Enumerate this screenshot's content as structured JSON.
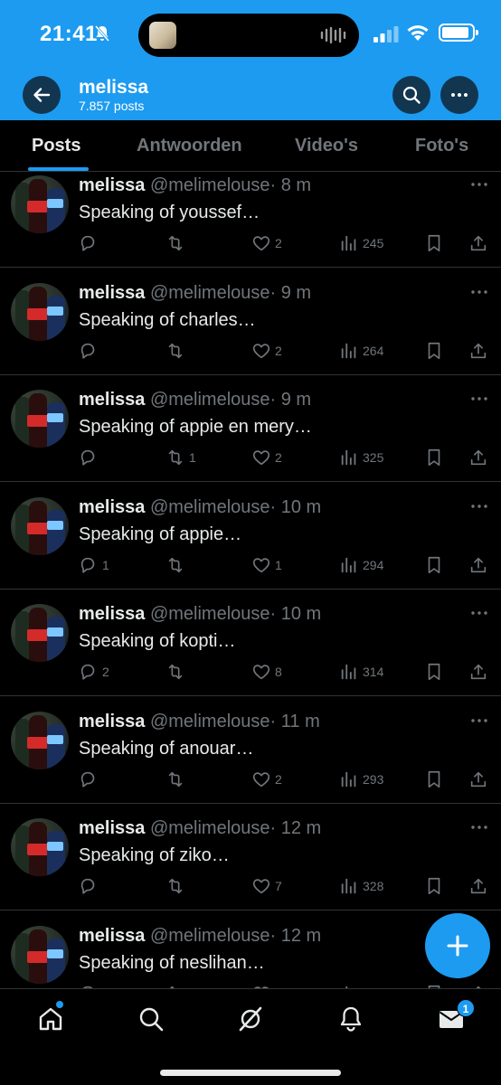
{
  "status_bar": {
    "time": "21:41"
  },
  "header": {
    "name": "melissa",
    "posts_count": "7.857 posts"
  },
  "tabs": [
    {
      "label": "Posts",
      "active": true
    },
    {
      "label": "Antwoorden",
      "active": false
    },
    {
      "label": "Video's",
      "active": false
    },
    {
      "label": "Foto's",
      "active": false
    }
  ],
  "posts": [
    {
      "name": "melissa",
      "handle": "@melimelouse",
      "time": "· 8 m",
      "text": "Speaking of youssef…",
      "replies": "",
      "reposts": "",
      "likes": "2",
      "views": "245"
    },
    {
      "name": "melissa",
      "handle": "@melimelouse",
      "time": "· 9 m",
      "text": "Speaking of charles…",
      "replies": "",
      "reposts": "",
      "likes": "2",
      "views": "264"
    },
    {
      "name": "melissa",
      "handle": "@melimelouse",
      "time": "· 9 m",
      "text": "Speaking of appie en mery…",
      "replies": "",
      "reposts": "1",
      "likes": "2",
      "views": "325"
    },
    {
      "name": "melissa",
      "handle": "@melimelouse",
      "time": "· 10 m",
      "text": "Speaking of appie…",
      "replies": "1",
      "reposts": "",
      "likes": "1",
      "views": "294"
    },
    {
      "name": "melissa",
      "handle": "@melimelouse",
      "time": "· 10 m",
      "text": "Speaking of kopti…",
      "replies": "2",
      "reposts": "",
      "likes": "8",
      "views": "314"
    },
    {
      "name": "melissa",
      "handle": "@melimelouse",
      "time": "· 11 m",
      "text": "Speaking of anouar…",
      "replies": "",
      "reposts": "",
      "likes": "2",
      "views": "293"
    },
    {
      "name": "melissa",
      "handle": "@melimelouse",
      "time": "· 12 m",
      "text": "Speaking of ziko…",
      "replies": "",
      "reposts": "",
      "likes": "7",
      "views": "328"
    },
    {
      "name": "melissa",
      "handle": "@melimelouse",
      "time": "· 12 m",
      "text": "Speaking of neslihan…",
      "replies": "",
      "reposts": "",
      "likes": "",
      "views": ""
    }
  ],
  "bottom_nav": {
    "items": [
      "home-icon",
      "search-icon",
      "grok-icon",
      "notifications-icon",
      "messages-icon"
    ],
    "messages_badge": "1"
  },
  "colors": {
    "accent": "#1d9bf0",
    "background": "#000000",
    "muted": "#71767b"
  }
}
